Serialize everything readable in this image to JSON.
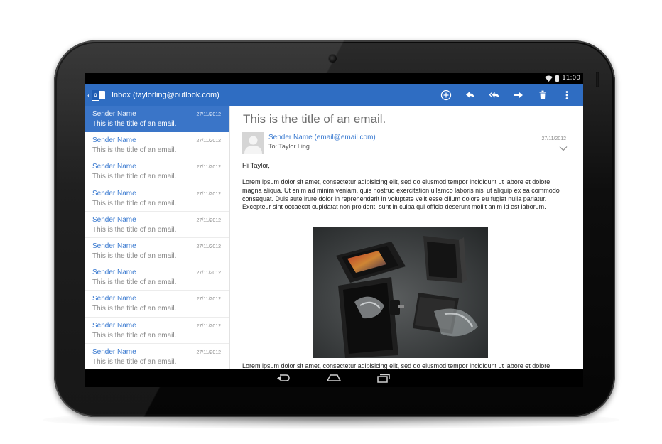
{
  "status_bar": {
    "time": "11:00",
    "wifi_icon": "wifi-icon",
    "battery_icon": "battery-icon"
  },
  "action_bar": {
    "title": "Inbox (taylorling@outlook.com)",
    "logo_letter": "o",
    "back_icon": "chevron-left-icon",
    "accent_color": "#2f6dc2",
    "actions": [
      {
        "name": "new-email",
        "icon": "plus-circle-icon"
      },
      {
        "name": "reply",
        "icon": "reply-icon"
      },
      {
        "name": "reply-all",
        "icon": "reply-all-icon"
      },
      {
        "name": "forward",
        "icon": "forward-icon"
      },
      {
        "name": "delete",
        "icon": "trash-icon"
      },
      {
        "name": "overflow",
        "icon": "more-vertical-icon"
      }
    ]
  },
  "email_list": {
    "selected_index": 0,
    "selected_color": "#3a75c8",
    "items": [
      {
        "sender": "Sender Name",
        "date": "27/11/2012",
        "subject": "This is the title of an email."
      },
      {
        "sender": "Sender Name",
        "date": "27/11/2012",
        "subject": "This is the title of an email."
      },
      {
        "sender": "Sender Name",
        "date": "27/11/2012",
        "subject": "This is the title of an email."
      },
      {
        "sender": "Sender Name",
        "date": "27/11/2012",
        "subject": "This is the title of an email."
      },
      {
        "sender": "Sender Name",
        "date": "27/11/2012",
        "subject": "This is the title of an email."
      },
      {
        "sender": "Sender Name",
        "date": "27/11/2012",
        "subject": "This is the title of an email."
      },
      {
        "sender": "Sender Name",
        "date": "27/11/2012",
        "subject": "This is the title of an email."
      },
      {
        "sender": "Sender Name",
        "date": "27/11/2012",
        "subject": "This is the title of an email."
      },
      {
        "sender": "Sender Name",
        "date": "27/11/2012",
        "subject": "This is the title of an email."
      },
      {
        "sender": "Sender Name",
        "date": "27/11/2012",
        "subject": "This is the title of an email."
      }
    ]
  },
  "reading_pane": {
    "title": "This is the title of an email.",
    "from": "Sender Name (email@email.com)",
    "to": "To: Taylor Ling",
    "date": "27/11/2012",
    "greeting": "Hi Taylor,",
    "paragraph_1": "Lorem ipsum dolor sit amet, consectetur adipisicing elit, sed do eiusmod tempor incididunt ut labore et dolore magna aliqua. Ut enim ad minim veniam, quis nostrud exercitation ullamco laboris nisi ut aliquip ex ea commodo consequat. Duis aute irure dolor in reprehenderit in voluptate velit esse cillum dolore eu fugiat nulla pariatur. Excepteur sint occaecat cupidatat non proident, sunt in culpa qui officia deserunt mollit anim id est laborum.",
    "paragraph_2": "Lorem ipsum dolor sit amet, consectetur adipisicing elit, sed do eiusmod tempor incididunt ut labore et dolore magna aliqua."
  },
  "nav_bar": {
    "buttons": [
      {
        "name": "back",
        "icon": "back-arrow-icon"
      },
      {
        "name": "home",
        "icon": "home-icon"
      },
      {
        "name": "recents",
        "icon": "recent-apps-icon"
      }
    ]
  }
}
